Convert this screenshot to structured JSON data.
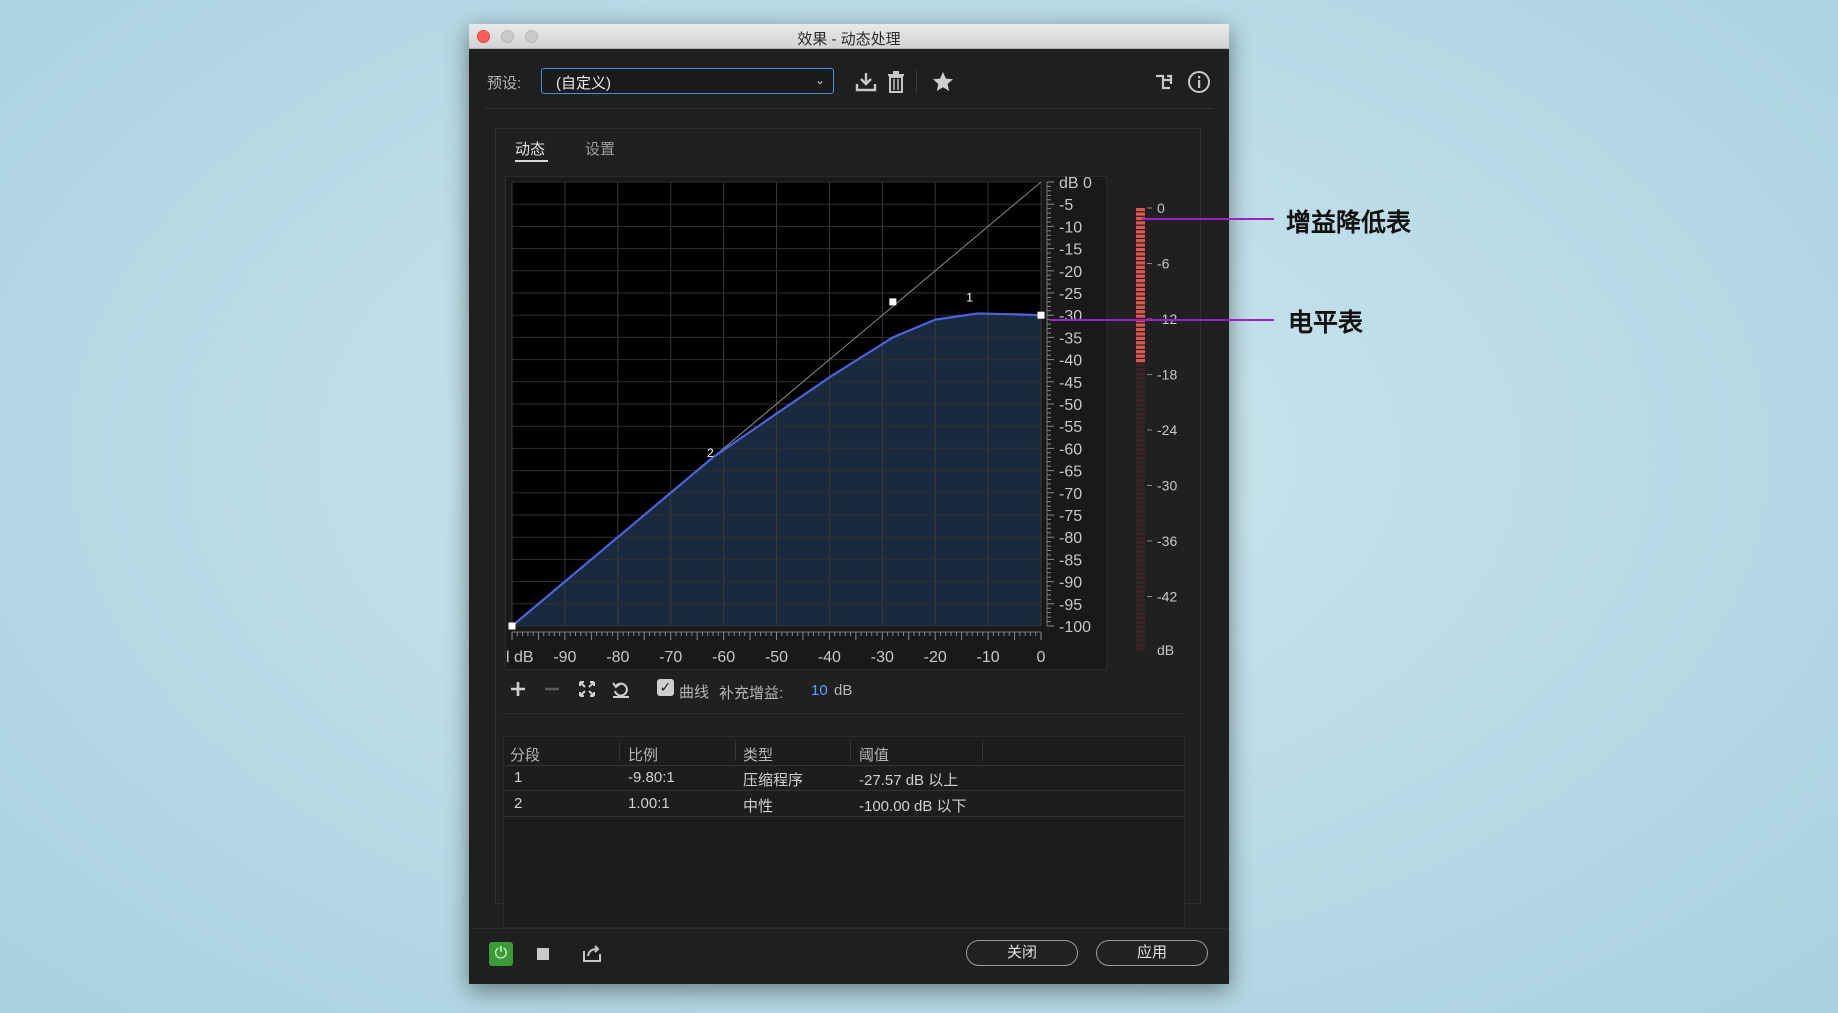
{
  "window": {
    "title": "效果 - 动态处理"
  },
  "preset": {
    "label": "预设:",
    "value": "(自定义)"
  },
  "tabs": [
    {
      "label": "动态"
    },
    {
      "label": "设置"
    }
  ],
  "graph": {
    "y_tick_labels": [
      "dB 0",
      "-5",
      "-10",
      "-15",
      "-20",
      "-25",
      "-30",
      "-35",
      "-40",
      "-45",
      "-50",
      "-55",
      "-60",
      "-65",
      "-70",
      "-75",
      "-80",
      "-85",
      "-90",
      "-95",
      "-100"
    ],
    "x_tick_labels": [
      "l dB",
      "-90",
      "-80",
      "-70",
      "-60",
      "-50",
      "-40",
      "-30",
      "-20",
      "-10",
      "0"
    ],
    "point_labels": [
      "1",
      "2"
    ],
    "curve_points_db": [
      [
        -100,
        -100
      ],
      [
        -62,
        -62
      ],
      [
        -40,
        -44
      ],
      [
        -28,
        -35
      ],
      [
        -20,
        -31
      ],
      [
        -12,
        -29.6
      ],
      [
        -5,
        -29.8
      ],
      [
        0,
        -30
      ]
    ],
    "control_points_db": [
      [
        -100,
        -100
      ],
      [
        -28,
        -27
      ],
      [
        0,
        -30
      ]
    ]
  },
  "meter": {
    "labels": [
      "0",
      "-6",
      "-12",
      "-18",
      "-24",
      "-30",
      "-36",
      "-42",
      "dB"
    ],
    "active_fraction": 0.35
  },
  "toolbar": {
    "curve_label": "曲线",
    "curve_checked": true,
    "makeup_label": "补充增益:",
    "makeup_value": "10",
    "makeup_unit": "dB"
  },
  "table": {
    "headers": [
      "分段",
      "比例",
      "类型",
      "阈值"
    ],
    "rows": [
      {
        "segment": "1",
        "ratio": "-9.80:1",
        "type": "压缩程序",
        "threshold": "-27.57 dB 以上"
      },
      {
        "segment": "2",
        "ratio": "1.00:1",
        "type": "中性",
        "threshold": "-100.00 dB 以下"
      }
    ]
  },
  "buttons": {
    "close": "关闭",
    "apply": "应用"
  },
  "annotations": {
    "gain_reduction": "增益降低表",
    "level_meter": "电平表"
  },
  "colors": {
    "curve": "#4c63e0",
    "fill": "#1a2a3e",
    "meter_active": "#e0574e",
    "annotation_line": "#a020c8",
    "makeup_value": "#5aa0ff",
    "power_on": "#3b9a3a"
  }
}
